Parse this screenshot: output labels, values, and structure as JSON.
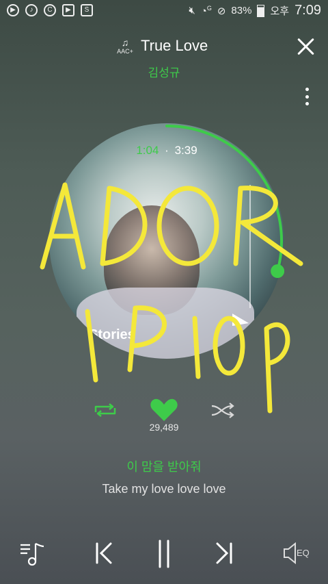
{
  "status_bar": {
    "battery": "83%",
    "ampm": "오후",
    "time": "7:09",
    "network": "G"
  },
  "header": {
    "quality_badge": "AAC+",
    "title": "True Love",
    "artist": "김성규"
  },
  "album": {
    "current_time": "1:04",
    "separator": "·",
    "total_time": "3:39",
    "progress": 0.2922,
    "cover_text": "Stories"
  },
  "handwriting": {
    "line1": "ADOR",
    "line2": "IP 100"
  },
  "actions": {
    "like_count": "29,489"
  },
  "lyrics": {
    "current": "이 맘을 받아줘",
    "next": "Take my love love love"
  },
  "controls": {
    "eq_label": "EQ"
  },
  "colors": {
    "accent": "#3ecb4a",
    "scribble": "#f4e83a"
  },
  "icons": {
    "status_left": [
      "play-circle-icon",
      "music-note-icon",
      "copyright-icon",
      "video-icon",
      "s-app-icon"
    ],
    "status_right": [
      "mute-icon",
      "wifi-icon",
      "no-disturb-icon",
      "battery-icon"
    ]
  }
}
